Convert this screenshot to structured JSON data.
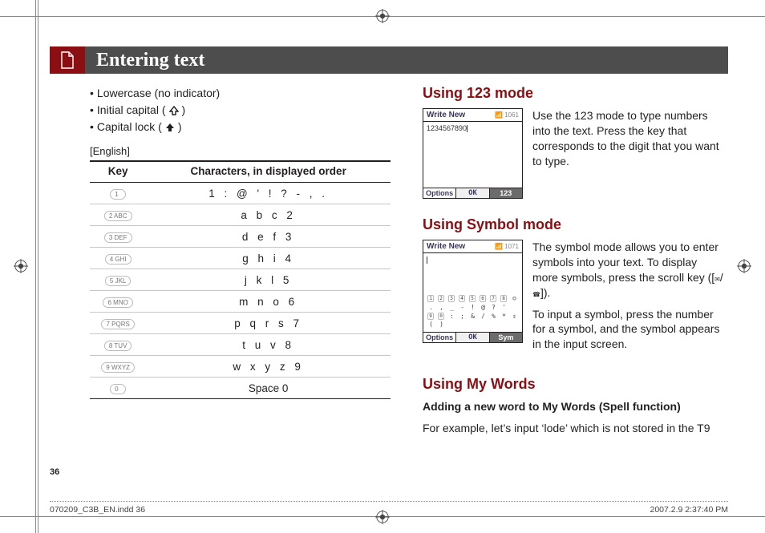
{
  "header": {
    "title": "Entering text"
  },
  "left": {
    "bullets": [
      {
        "text": "Lowercase (no indicator)"
      },
      {
        "text_prefix": "Initial capital (",
        "text_suffix": ")"
      },
      {
        "text_prefix": "Capital lock (",
        "text_suffix": ")"
      }
    ],
    "lang_label": "[English]",
    "table": {
      "head_key": "Key",
      "head_chars": "Characters, in displayed order",
      "rows": [
        {
          "key": "1",
          "chars": "1 : @ ' ! ? - , ."
        },
        {
          "key": "2 ABC",
          "chars": "a  b  c  2"
        },
        {
          "key": "3 DEF",
          "chars": "d  e  f  3"
        },
        {
          "key": "4 GHI",
          "chars": "g  h  i  4"
        },
        {
          "key": "5 JKL",
          "chars": "j  k  l  5"
        },
        {
          "key": "6 MNO",
          "chars": "m  n  o  6"
        },
        {
          "key": "7 PQRS",
          "chars": "p  q  r  s  7"
        },
        {
          "key": "8 TUV",
          "chars": "t  u  v  8"
        },
        {
          "key": "9 WXYZ",
          "chars": "w  x  y  z  9"
        },
        {
          "key": "0",
          "chars": "Space 0"
        }
      ]
    }
  },
  "right": {
    "s123": {
      "heading": "Using 123 mode",
      "text": "Use the 123 mode to type numbers into the text. Press the key that corresponds to the digit that you want to type.",
      "screen": {
        "title": "Write New",
        "signal": "1061",
        "body": "1234567890",
        "opt": "Options",
        "ok": "OK",
        "mode": "123"
      }
    },
    "sym": {
      "heading": "Using Symbol mode",
      "p1a": "The symbol mode allows you to enter symbols into your text. To display more symbols, press the scroll key ([",
      "p1b": "]).",
      "p2": "To input a symbol, press the number for a symbol, and the symbol appears in the input screen.",
      "screen": {
        "title": "Write New",
        "signal": "1071",
        "opt": "Options",
        "ok": "OK",
        "mode": "Sym"
      }
    },
    "words": {
      "heading": "Using My Words",
      "sub": "Adding a new word to My Words (Spell function)",
      "text": "For example, let’s input ‘lode’ which is not stored in the T9"
    }
  },
  "page_number": "36",
  "footer": {
    "left": "070209_C3B_EN.indd   36",
    "right": "2007.2.9   2:37:40 PM"
  }
}
